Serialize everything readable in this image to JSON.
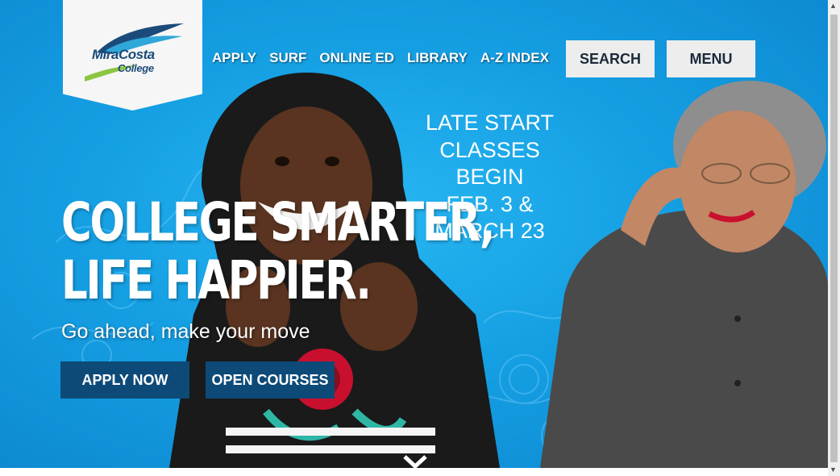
{
  "logo": {
    "line1": "MiraCosta",
    "line2": "College"
  },
  "nav": {
    "items": [
      "APPLY",
      "SURF",
      "ONLINE ED",
      "LIBRARY",
      "A-Z INDEX"
    ]
  },
  "buttons": {
    "search": "SEARCH",
    "menu": "MENU"
  },
  "hero": {
    "announcement": [
      "LATE START",
      "CLASSES",
      "BEGIN",
      "FEB. 3 &",
      "MARCH 23"
    ],
    "headline_line1": "COLLEGE SMARTER,",
    "headline_line2": "LIFE HAPPIER.",
    "tagline": "Go ahead, make your move",
    "cta_apply": "APPLY NOW",
    "cta_open": "OPEN COURSES"
  },
  "colors": {
    "hero_blue": "#1aa3e6",
    "cta_navy": "#0d4a78",
    "logo_navy": "#1b4b7a"
  },
  "icons": {
    "scroll_down": "chevron-down-icon"
  }
}
